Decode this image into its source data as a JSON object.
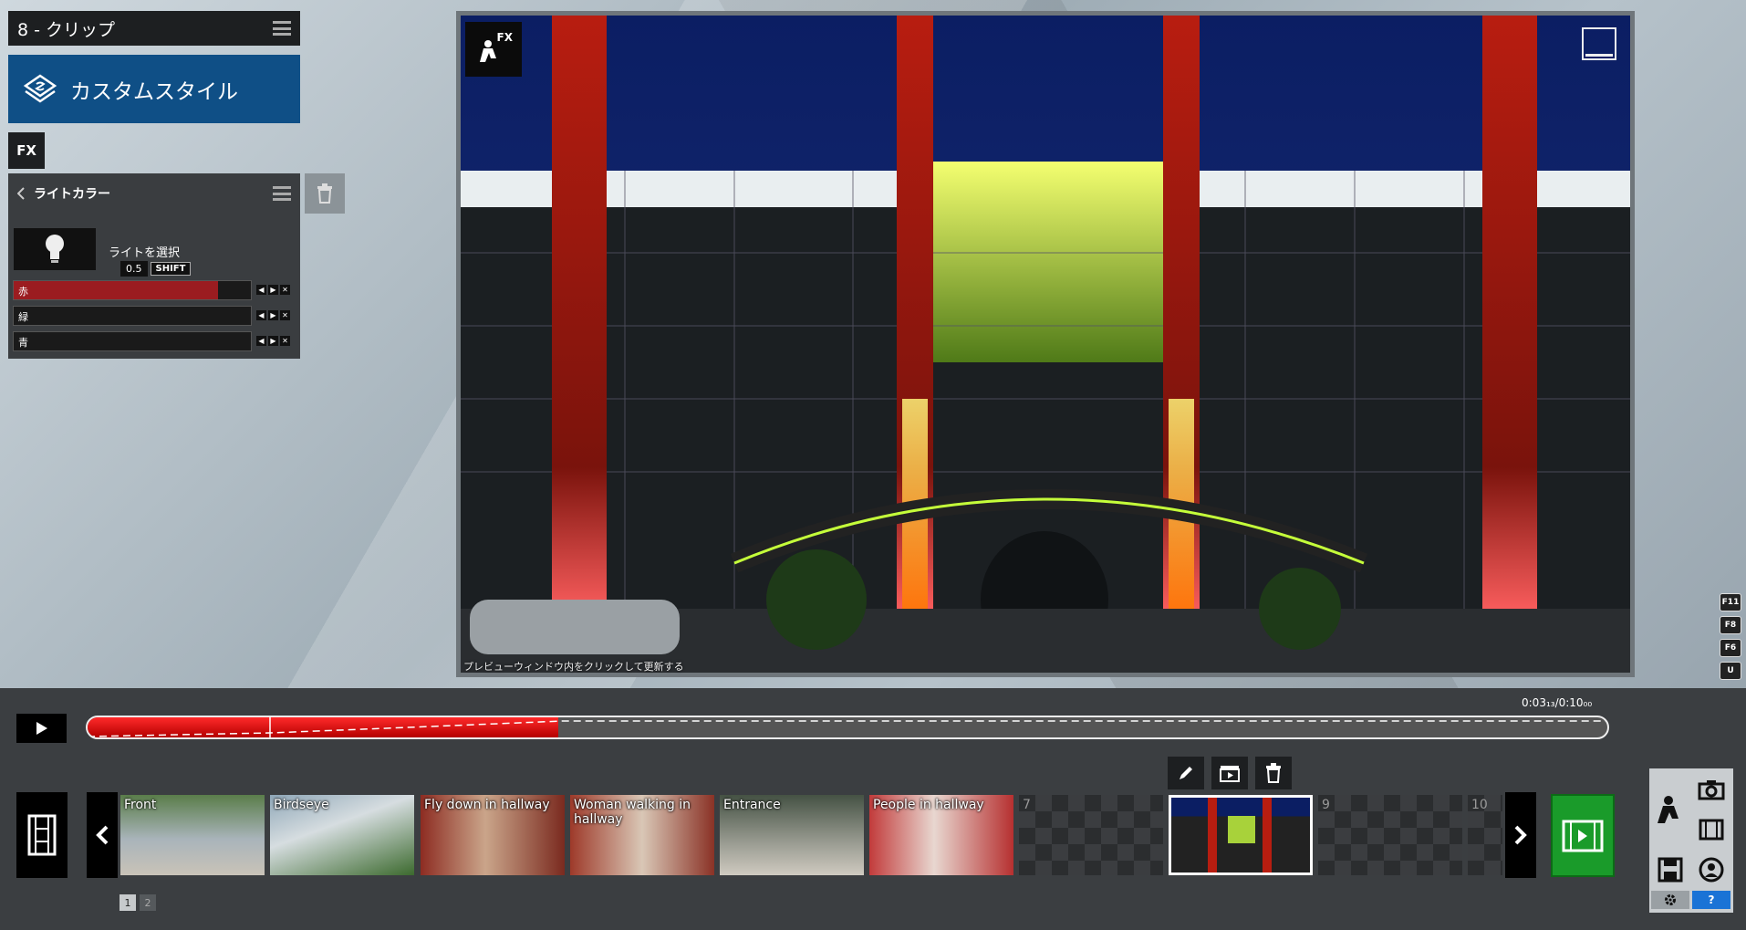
{
  "clip_header": {
    "title": "8 - クリップ"
  },
  "style_button": {
    "label": "カスタムスタイル"
  },
  "fx_button": {
    "label": "FX"
  },
  "effect": {
    "title": "ライトカラー",
    "select_light_label": "ライトを選択",
    "step_value": "0.5",
    "shift_label": "SHIFT",
    "sliders": [
      {
        "label": "赤",
        "value": 0.86,
        "color": "#9b1c20"
      },
      {
        "label": "緑",
        "value": 0.0,
        "color": "#1f7a2a"
      },
      {
        "label": "青",
        "value": 0.0,
        "color": "#1f3f9a"
      }
    ]
  },
  "preview": {
    "badge": "FX",
    "hint": "プレビューウィンドウ内をクリックして更新する"
  },
  "fkeys": [
    "F11",
    "F8",
    "F6",
    "U"
  ],
  "timeline": {
    "timecode": "0:03₁₃/0:10₀₀",
    "progress": 0.31
  },
  "clips": [
    {
      "label": "Front",
      "type": "thumb"
    },
    {
      "label": "Birdseye",
      "type": "thumb"
    },
    {
      "label": "Fly down in hallway",
      "type": "thumb"
    },
    {
      "label": "Woman walking in hallway",
      "type": "thumb"
    },
    {
      "label": "Entrance",
      "type": "thumb"
    },
    {
      "label": "People in hallway",
      "type": "thumb"
    },
    {
      "label": "7",
      "type": "empty"
    },
    {
      "label": "",
      "type": "selected"
    },
    {
      "label": "9",
      "type": "empty"
    },
    {
      "label": "10",
      "type": "empty"
    }
  ],
  "pages": [
    "1",
    "2"
  ],
  "colors": {
    "accent_blue": "#0f4f86",
    "red": "#e00000",
    "green_render": "#1a9b2a"
  }
}
